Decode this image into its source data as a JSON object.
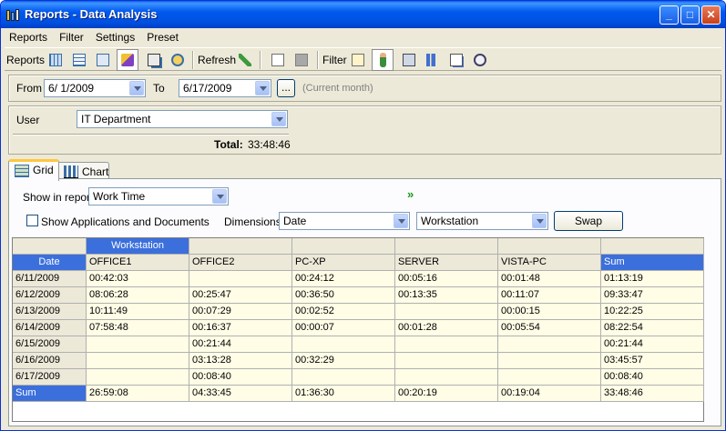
{
  "window": {
    "title": "Reports - Data Analysis",
    "minimize": "_",
    "maximize": "□",
    "close": "✕"
  },
  "menu": [
    "Reports",
    "Filter",
    "Settings",
    "Preset"
  ],
  "toolbar": {
    "reports_label": "Reports",
    "refresh_label": "Refresh",
    "filter_label": "Filter"
  },
  "date_range": {
    "from_label": "From",
    "from_value": "6/ 1/2009",
    "to_label": "To",
    "to_value": "6/17/2009",
    "ellipsis": "...",
    "note": "(Current month)"
  },
  "user_panel": {
    "user_label": "User",
    "user_value": "IT Department",
    "total_label": "Total:",
    "total_value": "33:48:46"
  },
  "tabs": [
    {
      "label": "Grid"
    },
    {
      "label": "Chart"
    }
  ],
  "options": {
    "show_in_report_label": "Show in report",
    "show_in_report_value": "Work Time",
    "show_apps_label": "Show Applications and Documents",
    "dimensions_label": "Dimensions",
    "dimension1_value": "Date",
    "dimension2_value": "Workstation",
    "swap_label": "Swap"
  },
  "grid": {
    "group_header": "Workstation",
    "row_header_title": "Date",
    "columns": [
      "OFFICE1",
      "OFFICE2",
      "PC-XP",
      "SERVER",
      "VISTA-PC",
      "Sum"
    ],
    "rows": [
      {
        "date": "6/11/2009",
        "values": [
          "00:42:03",
          "",
          "00:24:12",
          "00:05:16",
          "00:01:48",
          "01:13:19"
        ]
      },
      {
        "date": "6/12/2009",
        "values": [
          "08:06:28",
          "00:25:47",
          "00:36:50",
          "00:13:35",
          "00:11:07",
          "09:33:47"
        ]
      },
      {
        "date": "6/13/2009",
        "values": [
          "10:11:49",
          "00:07:29",
          "00:02:52",
          "",
          "00:00:15",
          "10:22:25"
        ]
      },
      {
        "date": "6/14/2009",
        "values": [
          "07:58:48",
          "00:16:37",
          "00:00:07",
          "00:01:28",
          "00:05:54",
          "08:22:54"
        ]
      },
      {
        "date": "6/15/2009",
        "values": [
          "",
          "00:21:44",
          "",
          "",
          "",
          "00:21:44"
        ]
      },
      {
        "date": "6/16/2009",
        "values": [
          "",
          "03:13:28",
          "00:32:29",
          "",
          "",
          "03:45:57"
        ]
      },
      {
        "date": "6/17/2009",
        "values": [
          "",
          "00:08:40",
          "",
          "",
          "",
          "00:08:40"
        ]
      }
    ],
    "sum_row": {
      "label": "Sum",
      "values": [
        "26:59:08",
        "04:33:45",
        "01:36:30",
        "00:20:19",
        "00:19:04",
        "33:48:46"
      ]
    }
  }
}
